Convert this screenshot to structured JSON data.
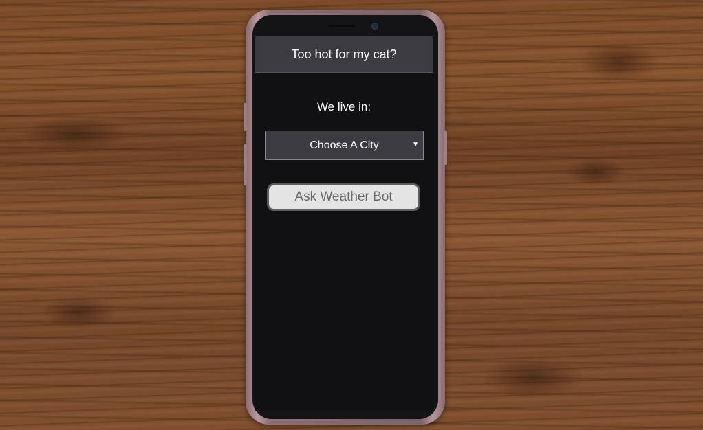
{
  "app": {
    "title": "Too hot for my cat?"
  },
  "form": {
    "location_label": "We live in:",
    "city_select": {
      "selected": "Choose A City"
    },
    "submit_label": "Ask Weather Bot"
  },
  "icons": {
    "dropdown": "chevron-down-icon"
  },
  "colors": {
    "header_bg": "#3c3b3f",
    "screen_bg": "#111113",
    "button_bg": "#e4e4e4",
    "button_text": "#6b6b6b"
  }
}
